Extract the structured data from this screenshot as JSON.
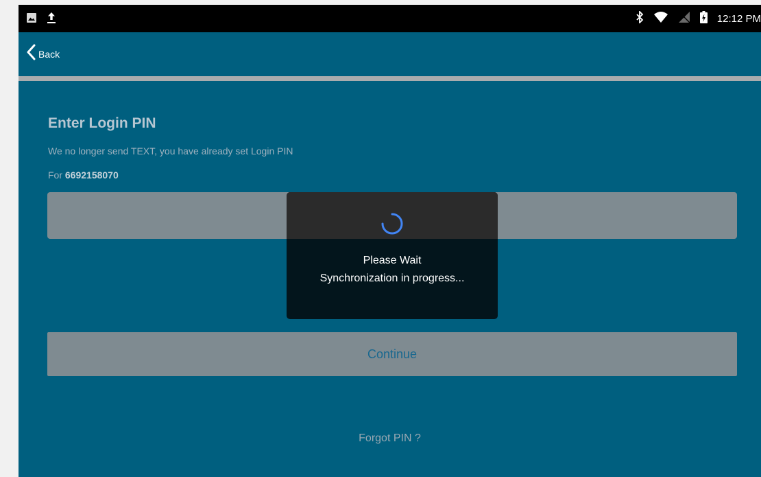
{
  "status_bar": {
    "time": "12:12 PM",
    "left_icons": [
      "image-icon",
      "upload-icon"
    ],
    "right_icons": [
      "bluetooth-icon",
      "wifi-icon",
      "signal-icon",
      "battery-charging-icon"
    ]
  },
  "app_bar": {
    "back_label": "Back"
  },
  "login": {
    "title": "Enter Login PIN",
    "subtitle": "We no longer send TEXT, you have already set Login PIN",
    "for_label": "For",
    "phone": "6692158070",
    "pin_value": "",
    "continue_label": "Continue",
    "forgot_label": "Forgot PIN ?"
  },
  "dialog": {
    "title": "Please Wait",
    "message": "Synchronization in progress..."
  },
  "colors": {
    "app_background": "#005f7f",
    "status_bar": "#000000",
    "spinner_accent": "#4285f4",
    "button_text": "#19688f"
  }
}
